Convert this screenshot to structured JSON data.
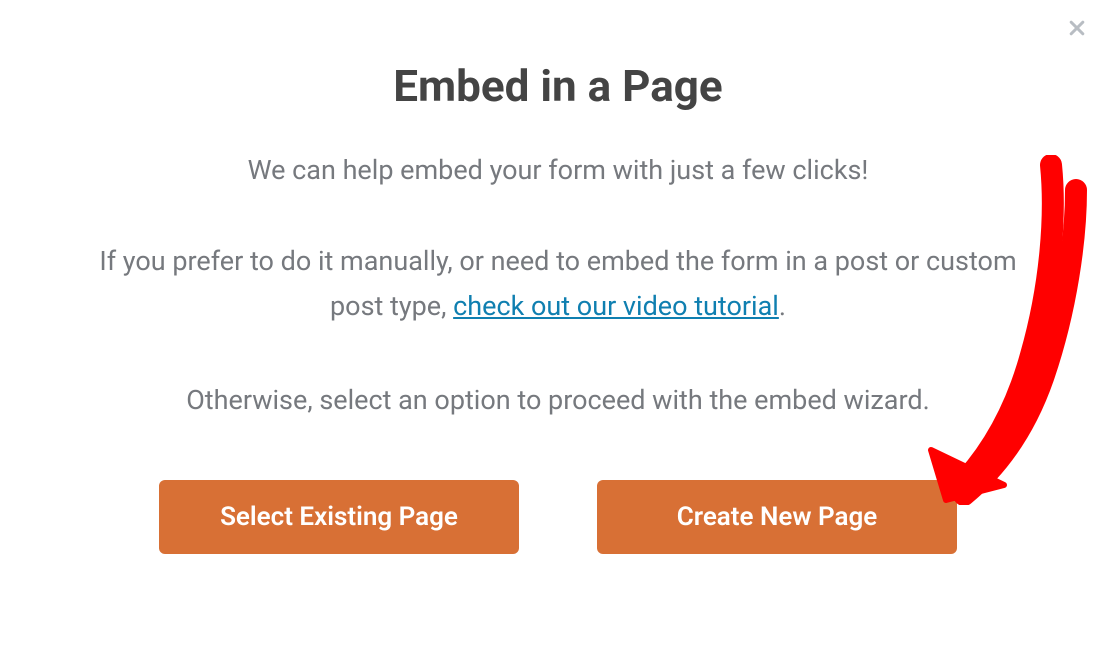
{
  "modal": {
    "title": "Embed in a Page",
    "subtitle": "We can help embed your form with just a few clicks!",
    "paragraph_lead": "If you prefer to do it manually, or need to embed the form in a post or custom post type, ",
    "link_text": "check out our video tutorial",
    "paragraph_tail": ".",
    "final_text": "Otherwise, select an option to proceed with the embed wizard.",
    "buttons": {
      "existing": "Select Existing Page",
      "create": "Create New Page"
    }
  },
  "colors": {
    "accent": "#d87035",
    "text_dark": "#444444",
    "text_muted": "#76797e",
    "link": "#0f7fb0",
    "annotation": "#ff0000"
  }
}
